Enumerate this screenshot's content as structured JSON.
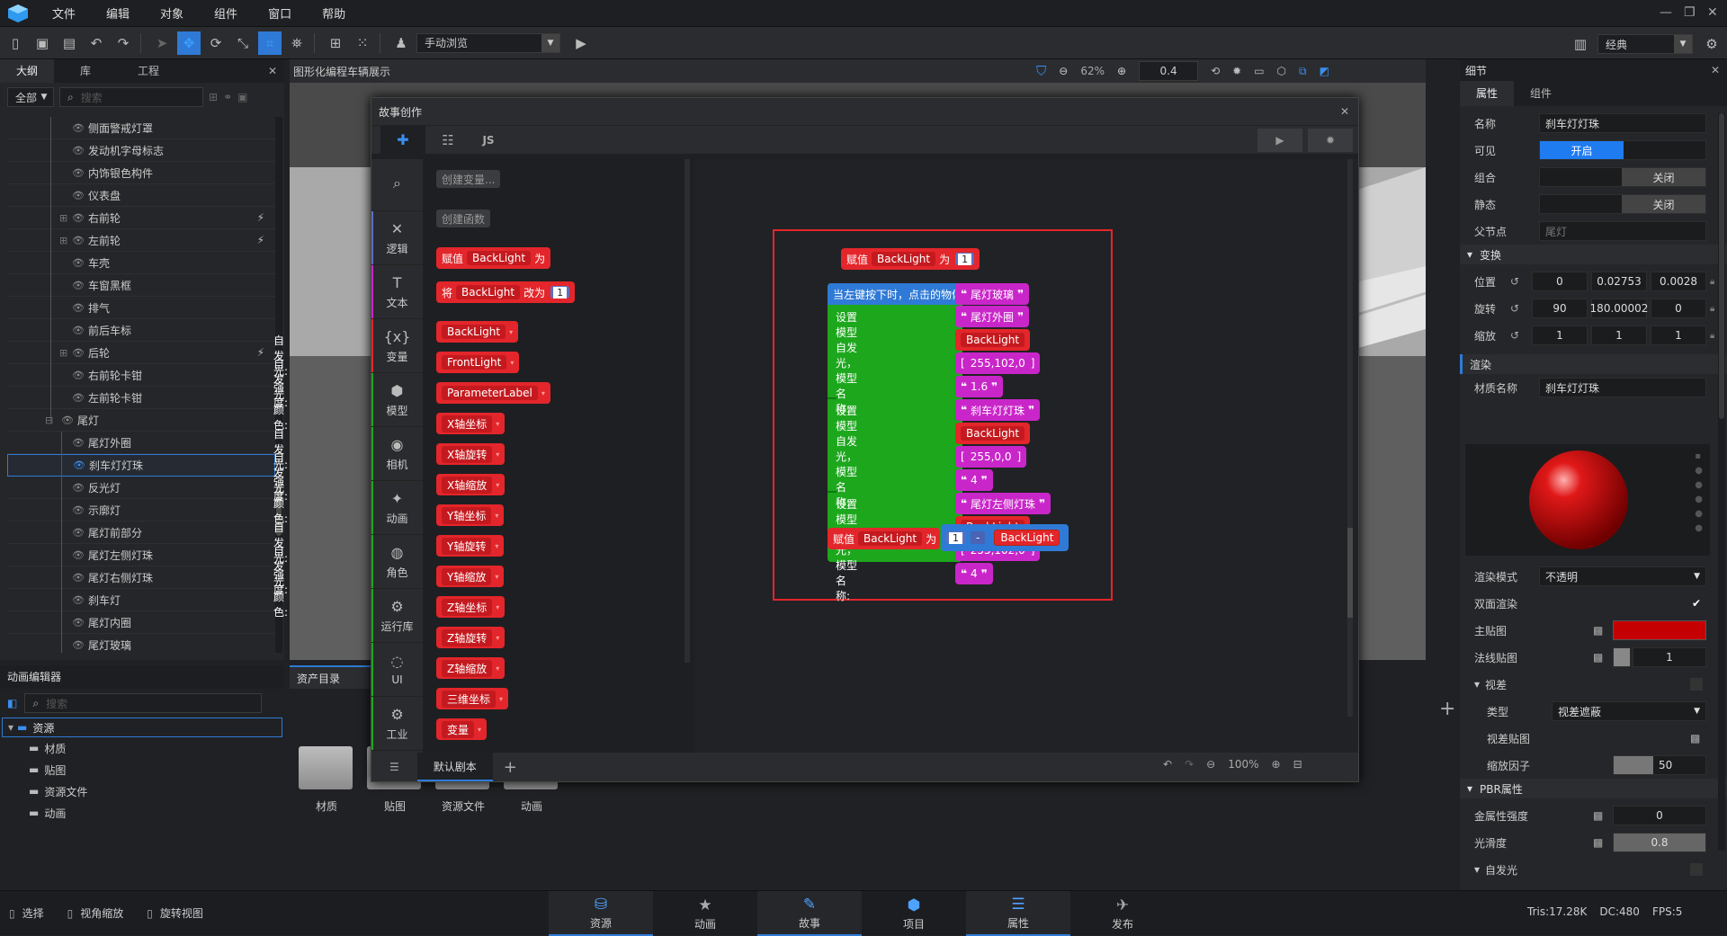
{
  "menu": [
    "文件",
    "编辑",
    "对象",
    "组件",
    "窗口",
    "帮助"
  ],
  "toolbar": {
    "mode_label": "手动浏览"
  },
  "outline": {
    "tabs": [
      "大纲",
      "库",
      "工程"
    ],
    "filter": "全部",
    "search_placeholder": "搜索",
    "items": [
      {
        "label": "侧面警戒灯罩",
        "indent": 1,
        "expander": false,
        "run": false
      },
      {
        "label": "发动机字母标志",
        "indent": 1,
        "expander": false,
        "run": false
      },
      {
        "label": "内饰银色构件",
        "indent": 1,
        "expander": false,
        "run": false
      },
      {
        "label": "仪表盘",
        "indent": 1,
        "expander": false,
        "run": false
      },
      {
        "label": "右前轮",
        "indent": 1,
        "expander": true,
        "run": true
      },
      {
        "label": "左前轮",
        "indent": 1,
        "expander": true,
        "run": true
      },
      {
        "label": "车壳",
        "indent": 1,
        "expander": false,
        "run": false
      },
      {
        "label": "车窗黑框",
        "indent": 1,
        "expander": false,
        "run": false
      },
      {
        "label": "排气",
        "indent": 1,
        "expander": false,
        "run": false
      },
      {
        "label": "前后车标",
        "indent": 1,
        "expander": false,
        "run": false
      },
      {
        "label": "后轮",
        "indent": 1,
        "expander": true,
        "run": true
      },
      {
        "label": "右前轮卡钳",
        "indent": 1,
        "expander": false,
        "run": false
      },
      {
        "label": "左前轮卡钳",
        "indent": 1,
        "expander": false,
        "run": false
      },
      {
        "label": "尾灯",
        "indent": 0,
        "expander": true,
        "run": false
      },
      {
        "label": "尾灯外圈",
        "indent": 1,
        "expander": false,
        "run": false
      },
      {
        "label": "刹车灯灯珠",
        "indent": 1,
        "expander": false,
        "run": false,
        "selected": true
      },
      {
        "label": "反光灯",
        "indent": 1,
        "expander": false,
        "run": false
      },
      {
        "label": "示廓灯",
        "indent": 1,
        "expander": false,
        "run": false
      },
      {
        "label": "尾灯前部分",
        "indent": 1,
        "expander": false,
        "run": false
      },
      {
        "label": "尾灯左侧灯珠",
        "indent": 1,
        "expander": false,
        "run": false
      },
      {
        "label": "尾灯右侧灯珠",
        "indent": 1,
        "expander": false,
        "run": false
      },
      {
        "label": "刹车灯",
        "indent": 1,
        "expander": false,
        "run": false
      },
      {
        "label": "尾灯内圈",
        "indent": 1,
        "expander": false,
        "run": false
      },
      {
        "label": "尾灯玻璃",
        "indent": 1,
        "expander": false,
        "run": false
      }
    ]
  },
  "viewport": {
    "title": "图形化编程车辆展示",
    "zoom": "62%",
    "speed": "0.4"
  },
  "story": {
    "title": "故事创作",
    "js_tab": "JS",
    "categories": [
      {
        "label": "",
        "icon": "⌕",
        "color": "#2a2b2e"
      },
      {
        "label": "逻辑",
        "icon": "✕",
        "color": "#5b6fbf"
      },
      {
        "label": "文本",
        "icon": "T",
        "color": "#c926c9"
      },
      {
        "label": "变量",
        "icon": "{x}",
        "color": "#e3262b"
      },
      {
        "label": "模型",
        "icon": "⬢",
        "color": "#1da71d"
      },
      {
        "label": "相机",
        "icon": "◉",
        "color": "#1da71d"
      },
      {
        "label": "动画",
        "icon": "✦",
        "color": "#1da71d"
      },
      {
        "label": "角色",
        "icon": "◍",
        "color": "#1da71d"
      },
      {
        "label": "运行库",
        "icon": "⚙",
        "color": "#1da71d"
      },
      {
        "label": "UI",
        "icon": "◌",
        "color": "#1da71d"
      },
      {
        "label": "工业",
        "icon": "⚙",
        "color": "#1da71d"
      }
    ],
    "flyout": {
      "create_var": "创建变量...",
      "create_func": "创建函数",
      "assign": "赋值",
      "to": "为",
      "var": "BackLight",
      "change": "将",
      "change_by": "改为",
      "num": "1",
      "vars": [
        "BackLight",
        "FrontLight",
        "ParameterLabel",
        "X轴坐标",
        "X轴旋转",
        "X轴缩放",
        "Y轴坐标",
        "Y轴旋转",
        "Y轴缩放",
        "Z轴坐标",
        "Z轴旋转",
        "Z轴缩放",
        "三维坐标",
        "变量"
      ]
    },
    "program": {
      "assign": "赋值",
      "var": "BackLight",
      "to": "为",
      "num": "1",
      "event": "当左键按下时，点击的物体为",
      "event_obj": "尾灯玻璃",
      "set_emissive": "设置模型自发光，模型名称:",
      "emissive": "自发光:",
      "emissive_color": "自发光颜色:",
      "strength": "强度:",
      "groups": [
        {
          "model": "尾灯外圈",
          "var": "BackLight",
          "color": "255,102,0",
          "strength": "1.6"
        },
        {
          "model": "刹车灯灯珠",
          "var": "BackLight",
          "color": "255,0,0",
          "strength": "4"
        },
        {
          "model": "尾灯左侧灯珠",
          "var": "BackLight",
          "color": "255,102,0",
          "strength": "4"
        }
      ],
      "minus": "-"
    },
    "bottom_tab": "默认剧本",
    "zoom": "100%"
  },
  "anim": {
    "title": "动画编辑器",
    "search_placeholder": "搜索",
    "root": "资源",
    "folders": [
      "材质",
      "贴图",
      "资源文件",
      "动画"
    ]
  },
  "asset": {
    "title": "资产目录",
    "folders": [
      "材质",
      "贴图",
      "资源文件",
      "动画"
    ]
  },
  "detail": {
    "title": "细节",
    "tabs": [
      "属性",
      "组件"
    ],
    "name_label": "名称",
    "name_value": "刹车灯灯珠",
    "visible_label": "可见",
    "visible_value": "开启",
    "group_label": "组合",
    "group_value": "关闭",
    "static_label": "静态",
    "static_value": "关闭",
    "parent_label": "父节点",
    "parent_value": "尾灯",
    "transform": "变换",
    "pos_label": "位置",
    "pos": [
      "0",
      "0.02753",
      "0.0028"
    ],
    "rot_label": "旋转",
    "rot": [
      "90",
      "180.00002",
      "0"
    ],
    "scale_label": "缩放",
    "scale": [
      "1",
      "1",
      "1"
    ],
    "render": "渲染",
    "material_label": "材质名称",
    "material_value": "刹车灯灯珠",
    "render_mode_label": "渲染模式",
    "render_mode": "不透明",
    "double_label": "双面渲染",
    "main_tex_label": "主贴图",
    "main_color": "#c40000",
    "normal_label": "法线贴图",
    "normal_value": "1",
    "parallax": "视差",
    "type_label": "类型",
    "type_value": "视差遮蔽",
    "parallax_tex": "视差贴图",
    "scale_factor_label": "缩放因子",
    "scale_factor": "50",
    "pbr": "PBR属性",
    "metal_label": "金属性强度",
    "metal_value": "0",
    "smooth_label": "光滑度",
    "smooth_value": "0.8",
    "emission": "自发光",
    "classic": "经典"
  },
  "status": {
    "left": [
      "选择",
      "视角缩放",
      "旋转视图"
    ],
    "tabs": [
      "资源",
      "动画",
      "故事",
      "项目",
      "属性",
      "发布"
    ],
    "tris": "Tris:17.28K",
    "dc": "DC:480",
    "fps": "FPS:5"
  }
}
